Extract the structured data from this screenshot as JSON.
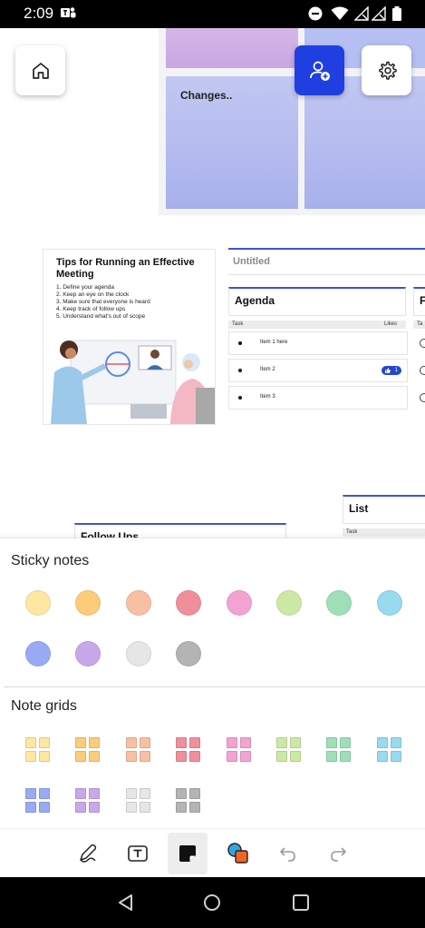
{
  "status_bar": {
    "time": "2:09"
  },
  "canvas": {
    "note_text": "Changes..",
    "tips": {
      "title": "Tips for Running an Effective Meeting",
      "items": [
        "1. Define your agenda",
        "2. Keep an eye on the clock",
        "3. Make sure that everyone is heard",
        "4. Keep track of follow ups",
        "5. Understand what's out of scope"
      ]
    },
    "untitled": "Untitled",
    "agenda": {
      "title": "Agenda",
      "task_header": "Task",
      "likes_header": "Likes",
      "items": [
        "Item 1 here",
        "Item 2",
        "Item 3"
      ],
      "like_count": "1"
    },
    "partial_right_title": "F",
    "partial_right_header": "Ta",
    "list": {
      "title": "List",
      "task_header": "Task"
    },
    "follow_ups": "Follow Ups"
  },
  "sheet": {
    "sticky_title": "Sticky notes",
    "grids_title": "Note grids",
    "colors": [
      "#fde7a1",
      "#fccc7a",
      "#f8c0a2",
      "#f08f9a",
      "#f2a3d2",
      "#cce9a3",
      "#9edfb8",
      "#98daf0",
      "#9aaaf5",
      "#c9a8e9",
      "#e6e6e6",
      "#b4b4b4"
    ]
  },
  "toolbar": {
    "tools": [
      "pen-tool",
      "text-tool",
      "sticky-note-tool",
      "shapes-tool",
      "undo",
      "redo"
    ],
    "active": "sticky-note-tool"
  }
}
